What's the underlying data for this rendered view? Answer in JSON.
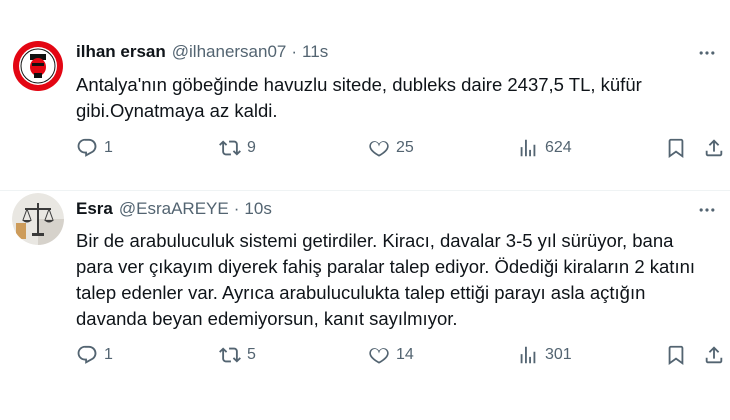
{
  "colors": {
    "text_primary": "#0f1419",
    "text_secondary": "#536471",
    "divider": "#eff3f4"
  },
  "tweets": [
    {
      "author_name": "ilhan ersan",
      "handle": "@ilhanersan07",
      "dot": "·",
      "time": "11s",
      "avatar_icon": "antalyaspor-logo",
      "avatar_logo_text": "ANTALYASPOR",
      "lines": [
        "Antalya'nın göbeğinde havuzlu sitede, dubleks daire 2437,5 TL, küfür",
        "gibi.Oynatmaya az kaldi."
      ],
      "replies": "1",
      "reposts": "9",
      "likes": "25",
      "views": "624"
    },
    {
      "author_name": "Esra",
      "handle": "@EsraAREYE",
      "dot": "·",
      "time": "10s",
      "avatar_icon": "scales-of-justice-avatar",
      "lines": [
        "Bir de arabuluculuk sistemi getirdiler. Kiracı, davalar 3-5 yıl sürüyor, bana",
        "para ver çıkayım diyerek fahiş paralar talep ediyor. Ödediği kiraların 2 katını",
        "talep edenler var. Ayrıca arabuluculukta talep ettiği parayı asla açtığın",
        "davanda beyan edemiyorsun, kanıt sayılmıyor."
      ],
      "replies": "1",
      "reposts": "5",
      "likes": "14",
      "views": "301"
    }
  ]
}
